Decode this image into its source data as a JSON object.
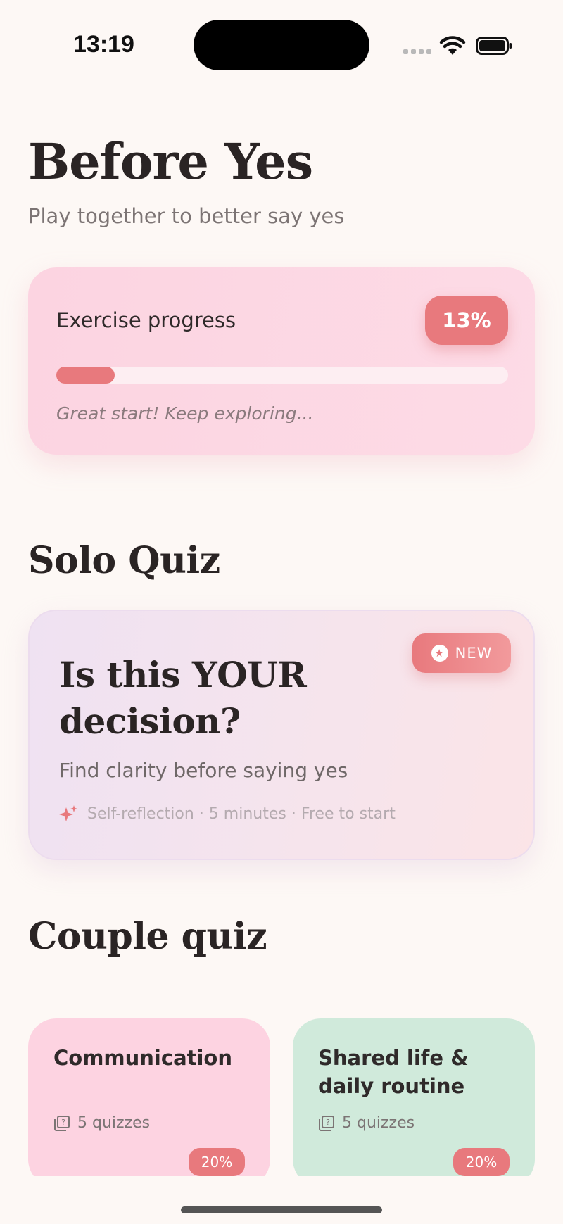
{
  "status_bar": {
    "time": "13:19"
  },
  "header": {
    "title": "Before Yes",
    "subtitle": "Play together to better say yes"
  },
  "progress": {
    "label": "Exercise progress",
    "percent_label": "13%",
    "percent_value": 13,
    "note": "Great start! Keep exploring..."
  },
  "solo_section": {
    "heading": "Solo Quiz",
    "badge": "NEW",
    "title": "Is this YOUR decision?",
    "description": "Find clarity before saying yes",
    "meta": "Self-reflection · 5 minutes · Free to start"
  },
  "couple_section": {
    "heading": "Couple quiz",
    "categories": [
      {
        "title": "Communication",
        "count": "5 quizzes",
        "percent": "20%",
        "color": "#fdd3e1"
      },
      {
        "title": "Shared life & daily routine",
        "count": "5 quizzes",
        "percent": "20%",
        "color": "#d0eadb"
      }
    ]
  },
  "colors": {
    "accent": "#e8797d",
    "background": "#fdf8f5"
  }
}
